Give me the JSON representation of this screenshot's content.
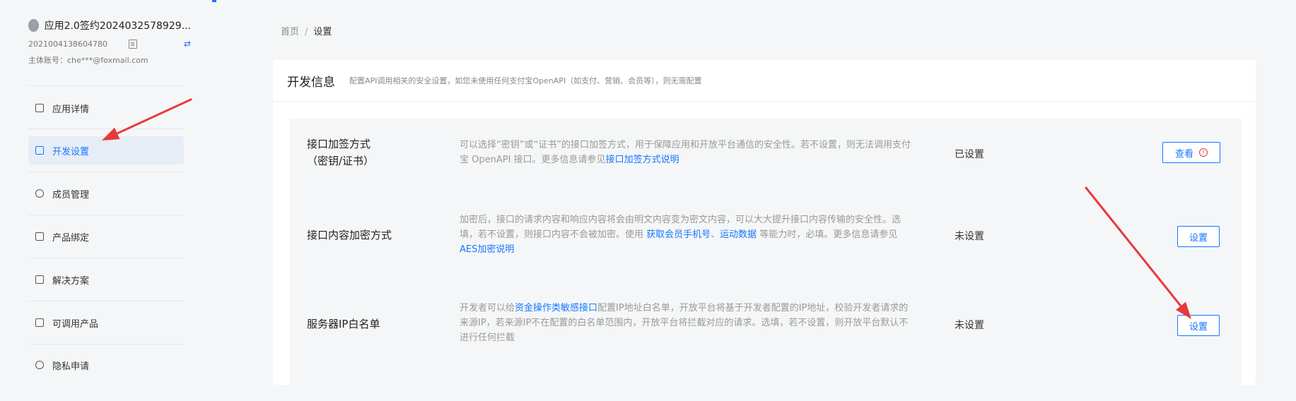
{
  "sidebar": {
    "app_title": "应用2.0签约2024032578929...",
    "app_id": "2021004138604780",
    "main_account": "主体账号：che***@foxmail.com",
    "items": [
      {
        "label": "应用详情"
      },
      {
        "label": "开发设置"
      },
      {
        "label": "成员管理"
      },
      {
        "label": "产品绑定"
      },
      {
        "label": "解决方案"
      },
      {
        "label": "可调用产品"
      },
      {
        "label": "隐私申请"
      }
    ],
    "active_index": 1
  },
  "breadcrumb": {
    "home": "首页",
    "separator": "/",
    "current": "设置"
  },
  "card": {
    "title": "开发信息",
    "description": "配置API调用相关的安全设置，如您未使用任何支付宝OpenAPI（如支付、营销、会员等），则无需配置"
  },
  "rows": [
    {
      "name_line1": "接口加签方式",
      "name_line2": "（密钥/证书）",
      "desc_text1": "可以选择“密钥”或“证书”的接口加签方式，用于保障应用和开放平台通信的安全性。若不设置，则无法调用支付宝 OpenAPI 接口。更多信息请参见",
      "desc_link1": "接口加签方式说明",
      "status": "已设置",
      "button": "查看",
      "button_warn_icon": "!"
    },
    {
      "name_line1": "接口内容加密方式",
      "desc_text1": "加密后，接口的请求内容和响应内容将会由明文内容变为密文内容，可以大大提升接口内容传输的安全性。选填，若不设置，则接口内容不会被加密。使用 ",
      "desc_link1": "获取会员手机号",
      "desc_text2": "、",
      "desc_link2": "运动数据",
      "desc_text3": " 等能力时，必填。更多信息请参见",
      "desc_link3": "AES加密说明",
      "status": "未设置",
      "button": "设置"
    },
    {
      "name_line1": "服务器IP白名单",
      "desc_text1": "开发者可以给",
      "desc_link1": "资金操作类敏感接口",
      "desc_text2": "配置IP地址白名单，开放平台将基于开发者配置的IP地址，校验开发者请求的来源IP，若来源IP不在配置的白名单范围内，开放平台将拦截对应的请求。选填，若不设置，则开放平台默认不进行任何拦截",
      "status": "未设置",
      "button": "设置"
    }
  ],
  "colors": {
    "accent": "#1677ff",
    "annotation_arrow": "#e8393a"
  }
}
